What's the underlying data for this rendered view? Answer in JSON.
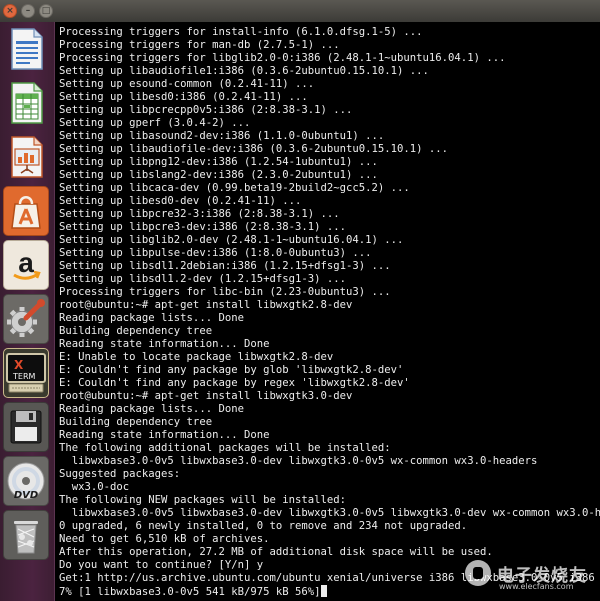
{
  "window": {
    "close_glyph": "×",
    "minimize_glyph": "–",
    "maximize_glyph": "□"
  },
  "launcher": {
    "items": [
      {
        "icon": "writer-document-icon"
      },
      {
        "icon": "calc-spreadsheet-icon"
      },
      {
        "icon": "impress-presentation-icon"
      },
      {
        "icon": "software-center-icon"
      },
      {
        "icon": "amazon-icon",
        "glyph": "a"
      },
      {
        "icon": "system-settings-icon"
      },
      {
        "icon": "xterm-icon",
        "label_top": "X",
        "label_bottom": "TERM"
      },
      {
        "icon": "floppy-disk-icon"
      },
      {
        "icon": "dvd-icon",
        "label": "DVD"
      },
      {
        "icon": "trash-icon"
      }
    ]
  },
  "terminal": {
    "lines": [
      "Processing triggers for install-info (6.1.0.dfsg.1-5) ...",
      "Processing triggers for man-db (2.7.5-1) ...",
      "Processing triggers for libglib2.0-0:i386 (2.48.1-1~ubuntu16.04.1) ...",
      "Setting up libaudiofile1:i386 (0.3.6-2ubuntu0.15.10.1) ...",
      "Setting up esound-common (0.2.41-11) ...",
      "Setting up libesd0:i386 (0.2.41-11) ...",
      "Setting up libpcrecpp0v5:i386 (2:8.38-3.1) ...",
      "Setting up gperf (3.0.4-2) ...",
      "Setting up libasound2-dev:i386 (1.1.0-0ubuntu1) ...",
      "Setting up libaudiofile-dev:i386 (0.3.6-2ubuntu0.15.10.1) ...",
      "Setting up libpng12-dev:i386 (1.2.54-1ubuntu1) ...",
      "Setting up libslang2-dev:i386 (2.3.0-2ubuntu1) ...",
      "Setting up libcaca-dev (0.99.beta19-2build2~gcc5.2) ...",
      "Setting up libesd0-dev (0.2.41-11) ...",
      "Setting up libpcre32-3:i386 (2:8.38-3.1) ...",
      "Setting up libpcre3-dev:i386 (2:8.38-3.1) ...",
      "Setting up libglib2.0-dev (2.48.1-1~ubuntu16.04.1) ...",
      "Setting up libpulse-dev:i386 (1:8.0-0ubuntu3) ...",
      "Setting up libsdl1.2debian:i386 (1.2.15+dfsg1-3) ...",
      "Setting up libsdl1.2-dev (1.2.15+dfsg1-3) ...",
      "Processing triggers for libc-bin (2.23-0ubuntu3) ...",
      "root@ubuntu:~# apt-get install libwxgtk2.8-dev",
      "Reading package lists... Done",
      "Building dependency tree",
      "Reading state information... Done",
      "E: Unable to locate package libwxgtk2.8-dev",
      "E: Couldn't find any package by glob 'libwxgtk2.8-dev'",
      "E: Couldn't find any package by regex 'libwxgtk2.8-dev'",
      "root@ubuntu:~# apt-get install libwxgtk3.0-dev",
      "Reading package lists... Done",
      "Building dependency tree",
      "Reading state information... Done",
      "The following additional packages will be installed:",
      "  libwxbase3.0-0v5 libwxbase3.0-dev libwxgtk3.0-0v5 wx-common wx3.0-headers",
      "Suggested packages:",
      "  wx3.0-doc",
      "The following NEW packages will be installed:",
      "  libwxbase3.0-0v5 libwxbase3.0-dev libwxgtk3.0-0v5 libwxgtk3.0-dev wx-common wx3.0-headers",
      "0 upgraded, 6 newly installed, 0 to remove and 234 not upgraded.",
      "Need to get 6,510 kB of archives.",
      "After this operation, 27.2 MB of additional disk space will be used.",
      "Do you want to continue? [Y/n] y",
      "Get:1 http://us.archive.ubuntu.com/ubuntu xenial/universe i386 libwxbase3.0-0v5 i386 3.0.2",
      "7% [1 libwxbase3.0-0v5 541 kB/975 kB 56%]"
    ]
  },
  "watermark": {
    "brand": "电子发烧友",
    "site": "www.elecfans.com"
  }
}
